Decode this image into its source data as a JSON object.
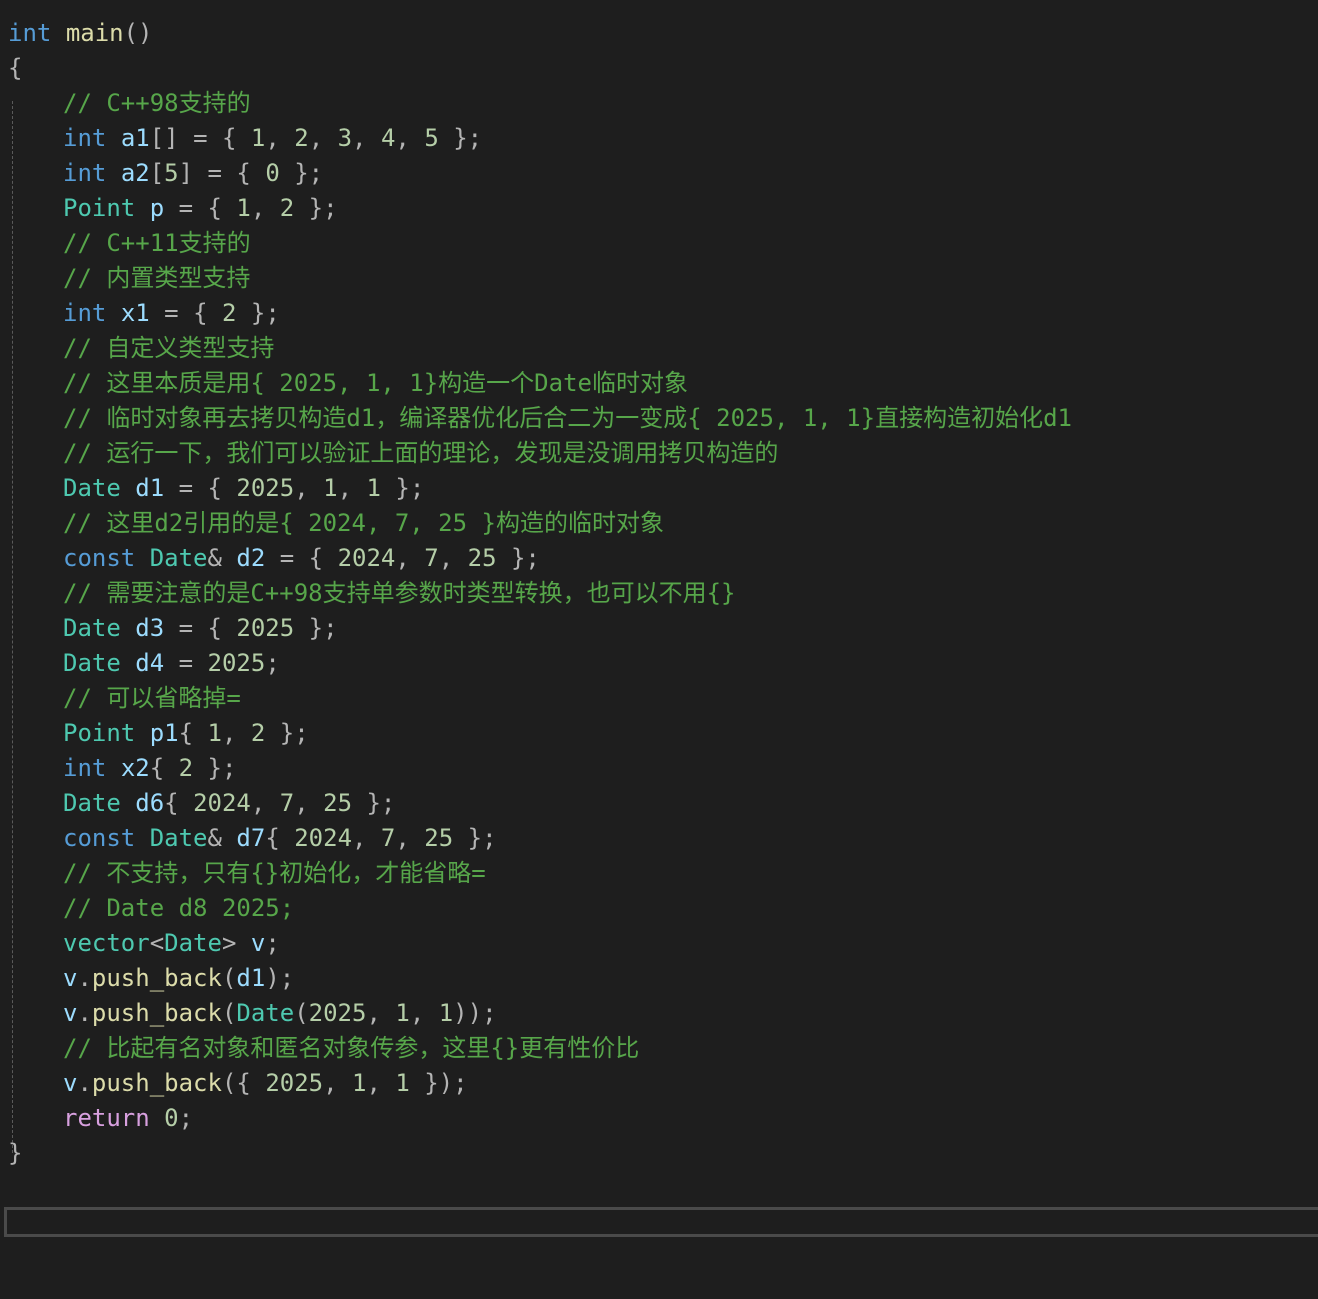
{
  "colors": {
    "background": "#1e1e1e",
    "keyword": "#569cd6",
    "type": "#4ec9b0",
    "variable": "#9cdcfe",
    "function": "#dcdcaa",
    "number": "#b5cea8",
    "punctuation": "#b4b4b4",
    "comment": "#57a64a",
    "control": "#d8a0df",
    "plain": "#dcdcdc"
  },
  "editor": {
    "lines": [
      {
        "indent": 0,
        "tokens": [
          [
            "kw",
            "int"
          ],
          [
            "plain",
            " "
          ],
          [
            "fn",
            "main"
          ],
          [
            "punc",
            "()"
          ]
        ]
      },
      {
        "indent": 0,
        "tokens": [
          [
            "punc",
            "{"
          ]
        ]
      },
      {
        "indent": 1,
        "tokens": [
          [
            "comment",
            "// C++98支持的"
          ]
        ]
      },
      {
        "indent": 1,
        "tokens": [
          [
            "kw",
            "int"
          ],
          [
            "plain",
            " "
          ],
          [
            "var",
            "a1"
          ],
          [
            "punc",
            "[] = { "
          ],
          [
            "num",
            "1"
          ],
          [
            "punc",
            ", "
          ],
          [
            "num",
            "2"
          ],
          [
            "punc",
            ", "
          ],
          [
            "num",
            "3"
          ],
          [
            "punc",
            ", "
          ],
          [
            "num",
            "4"
          ],
          [
            "punc",
            ", "
          ],
          [
            "num",
            "5"
          ],
          [
            "punc",
            " };"
          ]
        ]
      },
      {
        "indent": 1,
        "tokens": [
          [
            "kw",
            "int"
          ],
          [
            "plain",
            " "
          ],
          [
            "var",
            "a2"
          ],
          [
            "punc",
            "["
          ],
          [
            "num",
            "5"
          ],
          [
            "punc",
            "] = { "
          ],
          [
            "num",
            "0"
          ],
          [
            "punc",
            " };"
          ]
        ]
      },
      {
        "indent": 1,
        "tokens": [
          [
            "type",
            "Point"
          ],
          [
            "plain",
            " "
          ],
          [
            "var",
            "p"
          ],
          [
            "punc",
            " = { "
          ],
          [
            "num",
            "1"
          ],
          [
            "punc",
            ", "
          ],
          [
            "num",
            "2"
          ],
          [
            "punc",
            " };"
          ]
        ]
      },
      {
        "indent": 1,
        "tokens": [
          [
            "comment",
            "// C++11支持的"
          ]
        ]
      },
      {
        "indent": 1,
        "tokens": [
          [
            "comment",
            "// 内置类型支持"
          ]
        ]
      },
      {
        "indent": 1,
        "tokens": [
          [
            "kw",
            "int"
          ],
          [
            "plain",
            " "
          ],
          [
            "var",
            "x1"
          ],
          [
            "punc",
            " = { "
          ],
          [
            "num",
            "2"
          ],
          [
            "punc",
            " };"
          ]
        ]
      },
      {
        "indent": 1,
        "tokens": [
          [
            "comment",
            "// 自定义类型支持"
          ]
        ]
      },
      {
        "indent": 1,
        "tokens": [
          [
            "comment",
            "// 这里本质是用{ 2025, 1, 1}构造一个Date临时对象"
          ]
        ]
      },
      {
        "indent": 1,
        "tokens": [
          [
            "comment",
            "// 临时对象再去拷贝构造d1，编译器优化后合二为一变成{ 2025, 1, 1}直接构造初始化d1"
          ]
        ]
      },
      {
        "indent": 1,
        "tokens": [
          [
            "comment",
            "// 运行一下，我们可以验证上面的理论，发现是没调用拷贝构造的"
          ]
        ]
      },
      {
        "indent": 1,
        "tokens": [
          [
            "type",
            "Date"
          ],
          [
            "plain",
            " "
          ],
          [
            "var",
            "d1"
          ],
          [
            "punc",
            " = { "
          ],
          [
            "num",
            "2025"
          ],
          [
            "punc",
            ", "
          ],
          [
            "num",
            "1"
          ],
          [
            "punc",
            ", "
          ],
          [
            "num",
            "1"
          ],
          [
            "punc",
            " };"
          ]
        ]
      },
      {
        "indent": 1,
        "tokens": [
          [
            "comment",
            "// 这里d2引用的是{ 2024, 7, 25 }构造的临时对象"
          ]
        ]
      },
      {
        "indent": 1,
        "tokens": [
          [
            "kw",
            "const"
          ],
          [
            "plain",
            " "
          ],
          [
            "type",
            "Date"
          ],
          [
            "punc",
            "& "
          ],
          [
            "var",
            "d2"
          ],
          [
            "punc",
            " = { "
          ],
          [
            "num",
            "2024"
          ],
          [
            "punc",
            ", "
          ],
          [
            "num",
            "7"
          ],
          [
            "punc",
            ", "
          ],
          [
            "num",
            "25"
          ],
          [
            "punc",
            " };"
          ]
        ]
      },
      {
        "indent": 1,
        "tokens": [
          [
            "comment",
            "// 需要注意的是C++98支持单参数时类型转换，也可以不用{}"
          ]
        ]
      },
      {
        "indent": 1,
        "tokens": [
          [
            "type",
            "Date"
          ],
          [
            "plain",
            " "
          ],
          [
            "var",
            "d3"
          ],
          [
            "punc",
            " = { "
          ],
          [
            "num",
            "2025"
          ],
          [
            "punc",
            " };"
          ]
        ]
      },
      {
        "indent": 1,
        "tokens": [
          [
            "type",
            "Date"
          ],
          [
            "plain",
            " "
          ],
          [
            "var",
            "d4"
          ],
          [
            "punc",
            " = "
          ],
          [
            "num",
            "2025"
          ],
          [
            "punc",
            ";"
          ]
        ]
      },
      {
        "indent": 1,
        "tokens": [
          [
            "comment",
            "// 可以省略掉="
          ]
        ]
      },
      {
        "indent": 1,
        "tokens": [
          [
            "type",
            "Point"
          ],
          [
            "plain",
            " "
          ],
          [
            "var",
            "p1"
          ],
          [
            "punc",
            "{ "
          ],
          [
            "num",
            "1"
          ],
          [
            "punc",
            ", "
          ],
          [
            "num",
            "2"
          ],
          [
            "punc",
            " };"
          ]
        ]
      },
      {
        "indent": 1,
        "tokens": [
          [
            "kw",
            "int"
          ],
          [
            "plain",
            " "
          ],
          [
            "var",
            "x2"
          ],
          [
            "punc",
            "{ "
          ],
          [
            "num",
            "2"
          ],
          [
            "punc",
            " };"
          ]
        ]
      },
      {
        "indent": 1,
        "tokens": [
          [
            "type",
            "Date"
          ],
          [
            "plain",
            " "
          ],
          [
            "var",
            "d6"
          ],
          [
            "punc",
            "{ "
          ],
          [
            "num",
            "2024"
          ],
          [
            "punc",
            ", "
          ],
          [
            "num",
            "7"
          ],
          [
            "punc",
            ", "
          ],
          [
            "num",
            "25"
          ],
          [
            "punc",
            " };"
          ]
        ]
      },
      {
        "indent": 1,
        "tokens": [
          [
            "kw",
            "const"
          ],
          [
            "plain",
            " "
          ],
          [
            "type",
            "Date"
          ],
          [
            "punc",
            "& "
          ],
          [
            "var",
            "d7"
          ],
          [
            "punc",
            "{ "
          ],
          [
            "num",
            "2024"
          ],
          [
            "punc",
            ", "
          ],
          [
            "num",
            "7"
          ],
          [
            "punc",
            ", "
          ],
          [
            "num",
            "25"
          ],
          [
            "punc",
            " };"
          ]
        ]
      },
      {
        "indent": 1,
        "tokens": [
          [
            "comment",
            "// 不支持，只有{}初始化，才能省略="
          ]
        ]
      },
      {
        "indent": 1,
        "tokens": [
          [
            "comment",
            "// Date d8 2025;"
          ]
        ]
      },
      {
        "indent": 1,
        "tokens": [
          [
            "type",
            "vector"
          ],
          [
            "punc",
            "<"
          ],
          [
            "type",
            "Date"
          ],
          [
            "punc",
            "> "
          ],
          [
            "var",
            "v"
          ],
          [
            "punc",
            ";"
          ]
        ]
      },
      {
        "indent": 1,
        "tokens": [
          [
            "var",
            "v"
          ],
          [
            "punc",
            "."
          ],
          [
            "fn",
            "push_back"
          ],
          [
            "punc",
            "("
          ],
          [
            "var",
            "d1"
          ],
          [
            "punc",
            ");"
          ]
        ]
      },
      {
        "indent": 1,
        "tokens": [
          [
            "var",
            "v"
          ],
          [
            "punc",
            "."
          ],
          [
            "fn",
            "push_back"
          ],
          [
            "punc",
            "("
          ],
          [
            "type",
            "Date"
          ],
          [
            "punc",
            "("
          ],
          [
            "num",
            "2025"
          ],
          [
            "punc",
            ", "
          ],
          [
            "num",
            "1"
          ],
          [
            "punc",
            ", "
          ],
          [
            "num",
            "1"
          ],
          [
            "punc",
            "));"
          ]
        ]
      },
      {
        "indent": 1,
        "tokens": [
          [
            "comment",
            "// 比起有名对象和匿名对象传参，这里{}更有性价比"
          ]
        ]
      },
      {
        "indent": 1,
        "tokens": [
          [
            "var",
            "v"
          ],
          [
            "punc",
            "."
          ],
          [
            "fn",
            "push_back"
          ],
          [
            "punc",
            "({ "
          ],
          [
            "num",
            "2025"
          ],
          [
            "punc",
            ", "
          ],
          [
            "num",
            "1"
          ],
          [
            "punc",
            ", "
          ],
          [
            "num",
            "1"
          ],
          [
            "punc",
            " });"
          ]
        ]
      },
      {
        "indent": 1,
        "tokens": [
          [
            "ctrl",
            "return"
          ],
          [
            "plain",
            " "
          ],
          [
            "num",
            "0"
          ],
          [
            "punc",
            ";"
          ]
        ]
      },
      {
        "indent": 0,
        "tokens": [
          [
            "punc",
            "}"
          ]
        ]
      }
    ]
  }
}
